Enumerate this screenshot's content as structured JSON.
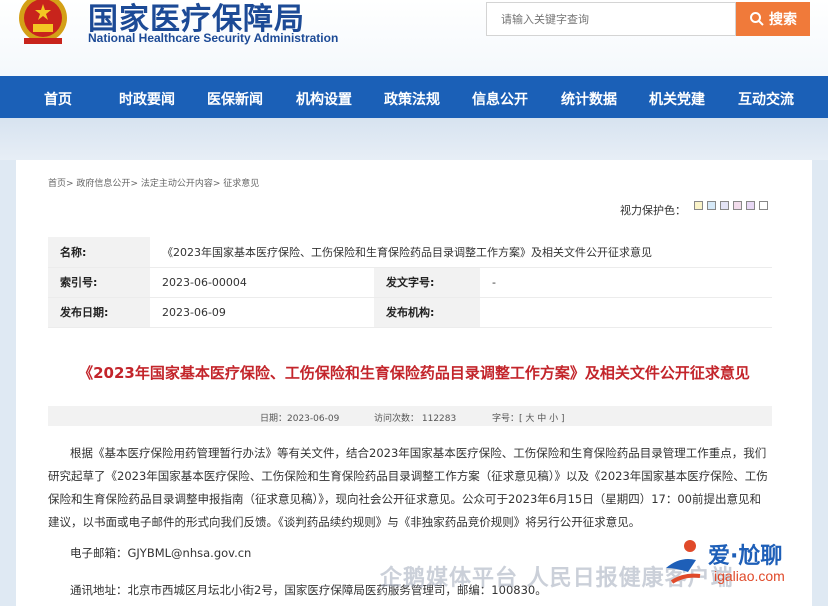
{
  "header": {
    "site_name_cn": "国家医疗保障局",
    "site_name_en": "National Healthcare Security Administration",
    "search_placeholder": "请输入关键字查询",
    "search_button": "搜索"
  },
  "nav": {
    "items": [
      "首页",
      "时政要闻",
      "医保新闻",
      "机构设置",
      "政策法规",
      "信息公开",
      "统计数据",
      "机关党建",
      "互动交流"
    ]
  },
  "breadcrumb": [
    "首页",
    "政府信息公开",
    "法定主动公开内容",
    "征求意见"
  ],
  "eye_protection": {
    "label": "视力保护色：",
    "colors": [
      "#faf3c8",
      "#d6e9f8",
      "#e3e3f5",
      "#f2dcec",
      "#e8d8f5",
      "#ffffff"
    ]
  },
  "meta": {
    "name_label": "名称:",
    "name_value": "《2023年国家基本医疗保险、工伤保险和生育保险药品目录调整工作方案》及相关文件公开征求意见",
    "index_label": "索引号:",
    "index_value": "2023-06-00004",
    "doc_no_label": "发文字号:",
    "doc_no_value": "-",
    "date_label": "发布日期:",
    "date_value": "2023-06-09",
    "org_label": "发布机构:",
    "org_value": ""
  },
  "article": {
    "title": "《2023年国家基本医疗保险、工伤保险和生育保险药品目录调整工作方案》及相关文件公开征求意见",
    "date": "日期：2023-06-09",
    "visits": "访问次数：  112283",
    "font_size_label": "字号：[ 大 中 小 ]",
    "lines": [
      "根据《基本医疗保险用药管理暂行办法》等有关文件，结合2023年国家基本医疗保险、工伤保险和生育保险药品目录管理工作重点，我们",
      "研究起草了《2023年国家基本医疗保险、工伤保险和生育保险药品目录调整工作方案（征求意见稿）》以及《2023年国家基本医疗保险、工伤",
      "保险和生育保险药品目录调整申报指南（征求意见稿）》，现向社会公开征求意见。公众可于2023年6月15日（星期四）17：00前提出意见和",
      "建议，以书面或电子邮件的形式向我们反馈。《谈判药品续约规则》与《非独家药品竞价规则》将另行公开征求意见。"
    ],
    "email": "电子邮箱：GJYBML@nhsa.gov.cn",
    "address": "通讯地址：北京市西城区月坛北小街2号，国家医疗保障局医药服务管理司，邮编：100830。"
  },
  "watermarks": {
    "text": "企鹅媒体平台 人民日报健康客户端",
    "logo_cn": "爱·尬聊",
    "logo_url": "igaliao.com"
  }
}
